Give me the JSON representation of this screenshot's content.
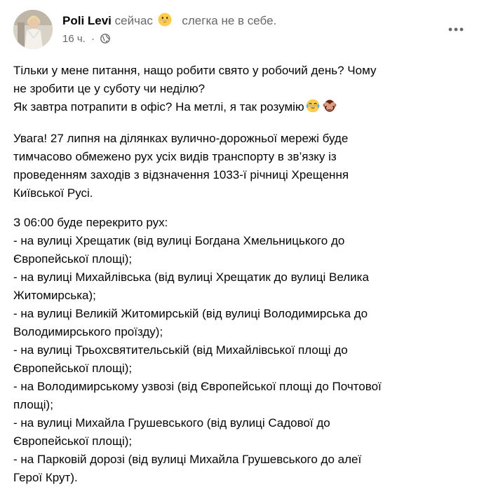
{
  "post": {
    "author_name": "Poli Levi",
    "status_prefix": "сейчас",
    "feeling_emoji": "grinning-face-emoji",
    "feeling": "слегка не в себе.",
    "time": "16 ч.",
    "dot": "·",
    "privacy_icon": "globe-icon",
    "more_icon": "more-options-icon"
  },
  "paragraph1": {
    "line1": "Тільки у мене питання, нащо робити свято у робочий день? Чому",
    "line2": "не зробити це у суботу чи неділю?",
    "line3": "Як завтра потрапити в офіс? На метлі, я так розумію",
    "emojis": [
      "face-with-tears-of-joy-emoji",
      "see-no-evil-monkey-emoji"
    ]
  },
  "paragraph2": {
    "line1": "Увага! 27 липня на ділянках вулично-дорожньої мережі буде",
    "line2": "тимчасово обмежено рух усіх видів транспорту в зв’язку із",
    "line3": "проведенням заходів з відзначення 1033-ї річниці Хрещення",
    "line4": "Київської Русі."
  },
  "paragraph3": {
    "lines": [
      "З 06:00 буде перекрито рух:",
      "- на вулиці Хрещатик (від вулиці Богдана Хмельницького до",
      "Європейської площі);",
      "- на вулиці Михайлівська (від вулиці Хрещатик до вулиці Велика",
      "Житомирська);",
      "- на вулиці Великій Житомирській (від вулиці Володимирська до",
      "Володимирського проїзду);",
      "- на вулиці Трьохсвятительській (від Михайлівської площі до",
      "Європейської площі);",
      "- на Володимирському узвозі (від Європейської площі до Почтової",
      "площі);",
      "- на вулиці Михайла Грушевського (від вулиці Садової до",
      "Європейської площі);",
      "- на Парковій дорозі (від вулиці Михайла Грушевського до алеї",
      "Герої Крут)."
    ]
  },
  "colors": {
    "text": "#050505",
    "secondary": "#65676b",
    "emoji_yellow": "#ffcc4d"
  }
}
